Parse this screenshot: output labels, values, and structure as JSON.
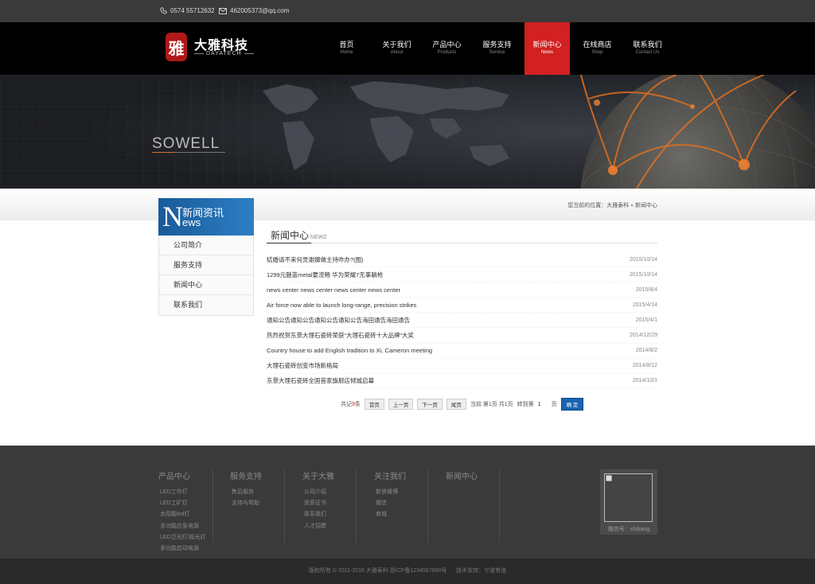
{
  "topbar": {
    "phone": "0574 55712632",
    "email": "462005373@qq.com"
  },
  "logo": {
    "badge": "雅",
    "name": "大雅科技",
    "name_en": "DAYATECH"
  },
  "nav": [
    {
      "cn": "首页",
      "en": "Home"
    },
    {
      "cn": "关于我们",
      "en": "About"
    },
    {
      "cn": "产品中心",
      "en": "Products"
    },
    {
      "cn": "服务支持",
      "en": "Service"
    },
    {
      "cn": "新闻中心",
      "en": "News",
      "active": true
    },
    {
      "cn": "在线商店",
      "en": "Shop"
    },
    {
      "cn": "联系我们",
      "en": "Contact Us"
    }
  ],
  "banner": {
    "text": "SOWELL"
  },
  "sidebar": {
    "head_letter": "N",
    "head_cn": "新闻资讯",
    "head_en": "ews",
    "items": [
      "公司简介",
      "服务支持",
      "新闻中心",
      "联系我们"
    ]
  },
  "breadcrumb": "您当前的位置：大雅泰科 » 新闻中心",
  "section": {
    "title": "新闻中心",
    "sub": "NEWZ"
  },
  "news": [
    {
      "title": "结婚请不来何炅谢娜做主持咋办?(图)",
      "date": "2015/10/14"
    },
    {
      "title": "1299元魅蓝metal要流畅 华为荣耀7无事躺枪",
      "date": "2015/10/14"
    },
    {
      "title": "news center news center news center news center",
      "date": "2015/8/4"
    },
    {
      "title": "Air force now able to launch long-range, precision strikes",
      "date": "2015/4/14"
    },
    {
      "title": "通知公告通知公告通知公告通知公告海田通告海田通告",
      "date": "2015/4/1"
    },
    {
      "title": "热烈祝贺东景大理石瓷砖荣获“大理石瓷砖十大品牌”大奖",
      "date": "2014/12/29"
    },
    {
      "title": "Country house to add English tradition to Xi, Cameron meeting",
      "date": "2014/8/2"
    },
    {
      "title": "大理石瓷砖创变市场新格局",
      "date": "2014/8/12"
    },
    {
      "title": "东景大理石瓷砖全国首家旗舰店倾城启幕",
      "date": "2014/10/1"
    }
  ],
  "pager": {
    "total_pre": "共记",
    "total_num": "9",
    "total_post": "条",
    "first": "首页",
    "prev": "上一页",
    "next": "下一页",
    "last": "尾页",
    "status": "当前:第1页 共1页",
    "goto": "转到第",
    "page_val": "1",
    "page_unit": "页",
    "go": "确 定"
  },
  "footer": {
    "cols": [
      {
        "title": "产品中心",
        "links": [
          "LED工作灯",
          "LED工矿灯",
          "太阳能led灯",
          "多功能应急电源",
          "LED泛光灯\\投光灯",
          "多功能启动电源"
        ]
      },
      {
        "title": "服务支持",
        "links": [
          "售后服务",
          "支持与帮助"
        ]
      },
      {
        "title": "关于大雅",
        "links": [
          "公司介绍",
          "资质证书",
          "联系我们",
          "人才招聘"
        ]
      },
      {
        "title": "关注我们",
        "links": [
          "新浪微博",
          "微信",
          "商城"
        ]
      },
      {
        "title": "新闻中心",
        "links": []
      }
    ],
    "wechat": "微信号：shibang",
    "copyright": "版权所有 © 2011-2016 大雅泰科 浙ICP备1234567890号",
    "support": "技术支持：宁波有道"
  },
  "colors": {
    "accent": "#d32020",
    "blue": "#2c7fc4",
    "orange": "#e07020"
  }
}
